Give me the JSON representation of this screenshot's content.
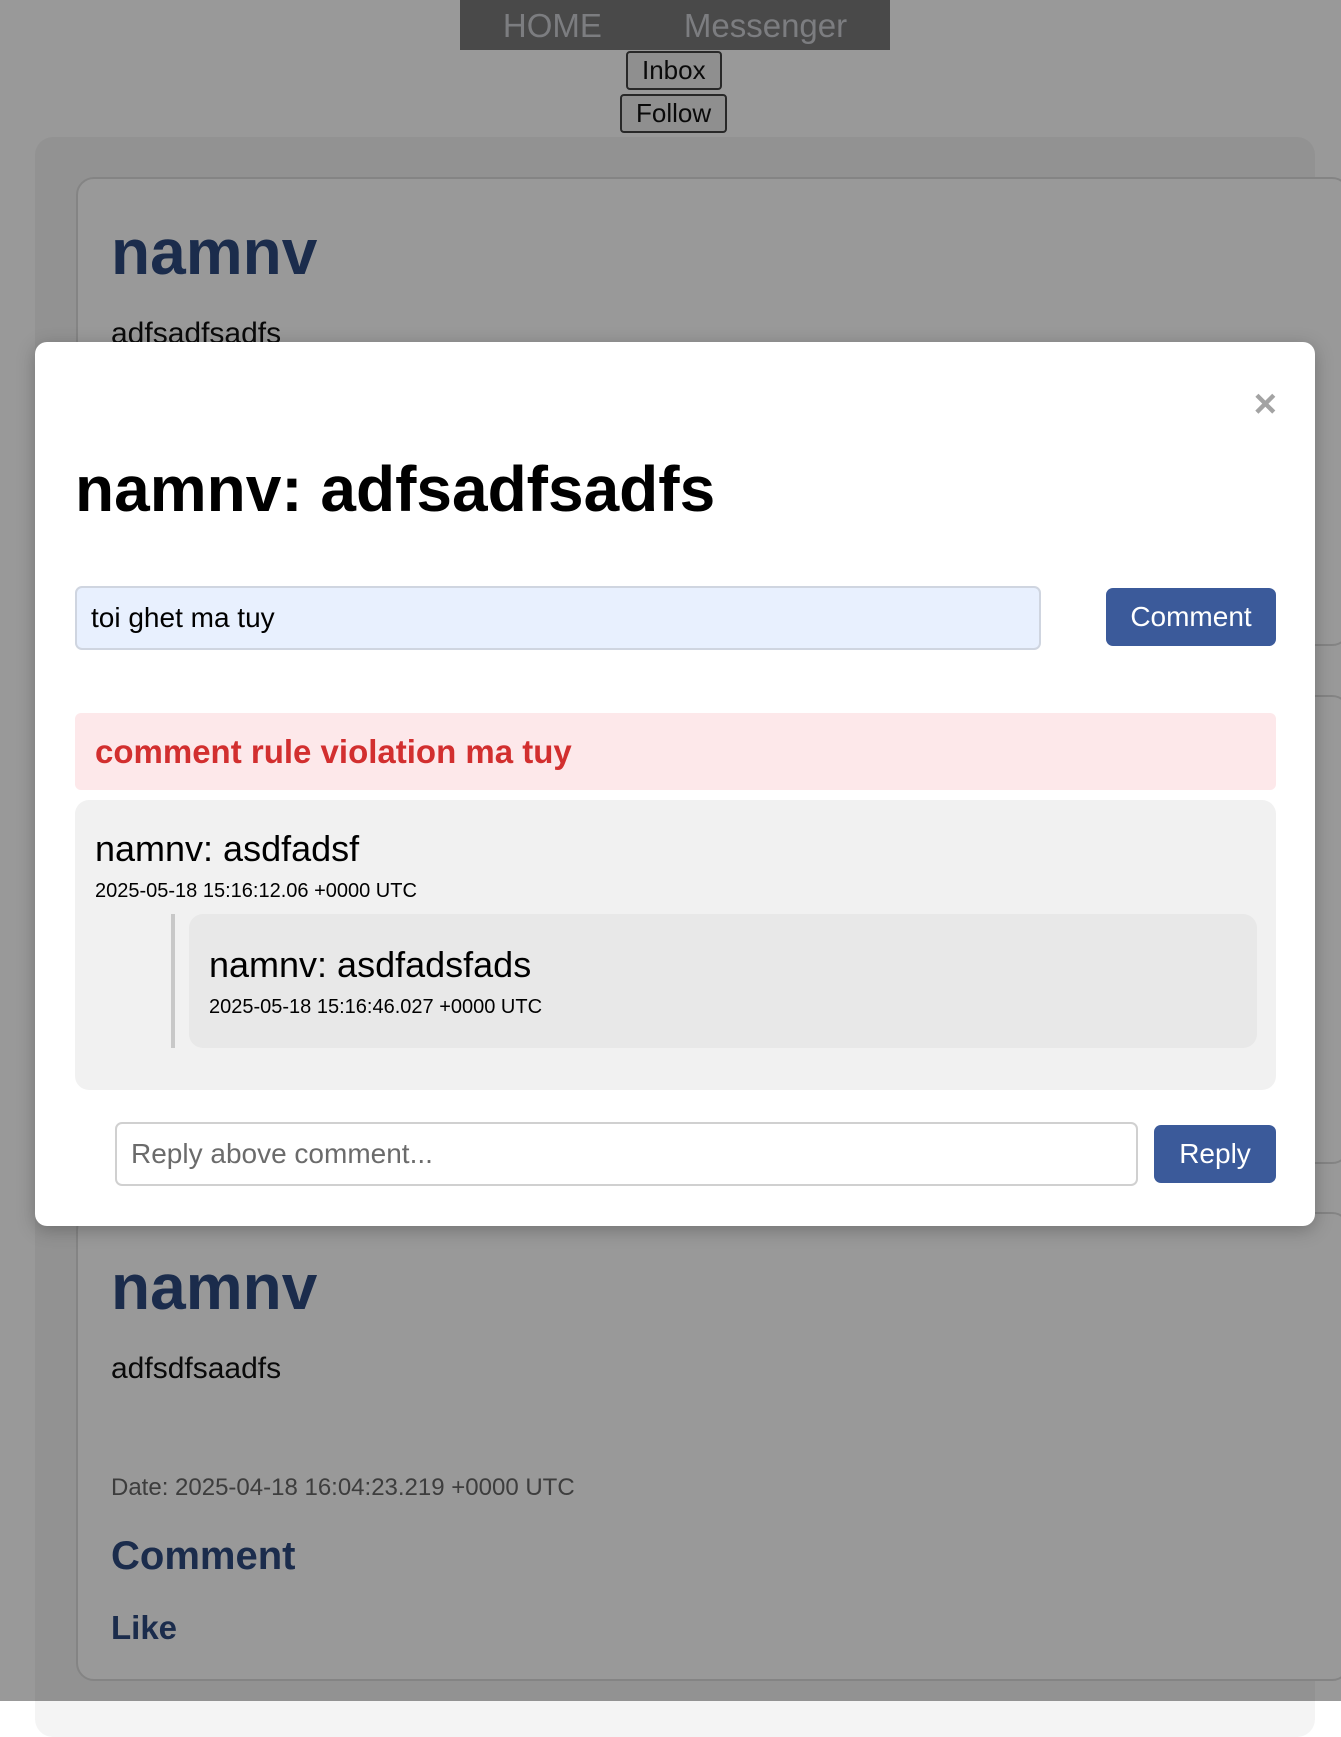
{
  "nav": {
    "home": "HOME",
    "messenger": "Messenger"
  },
  "buttons": {
    "inbox": "Inbox",
    "follow": "Follow"
  },
  "posts": [
    {
      "author": "namnv",
      "text": "adfsadfsadfs"
    },
    {
      "author": "namnv",
      "text": "adfsdfsaadfs",
      "date": "Date: 2025-04-18 16:04:23.219 +0000 UTC",
      "comment_link": "Comment",
      "like_link": "Like"
    }
  ],
  "modal": {
    "close_icon": "×",
    "title": "namnv: adfsadfsadfs",
    "comment_input_value": "toi ghet ma tuy",
    "comment_button": "Comment",
    "error_message": "comment rule violation ma tuy",
    "comments": [
      {
        "text": "namnv: asdfadsf",
        "date": "2025-05-18 15:16:12.06 +0000 UTC",
        "replies": [
          {
            "text": "namnv: asdfadsfads",
            "date": "2025-05-18 15:16:46.027 +0000 UTC"
          }
        ]
      }
    ],
    "reply_placeholder": "Reply above comment...",
    "reply_button": "Reply"
  },
  "colors": {
    "primary": "#3b5a9a",
    "author": "#2d4a7f",
    "error_text": "#d22f2f",
    "error_bg": "#fde8ea"
  }
}
